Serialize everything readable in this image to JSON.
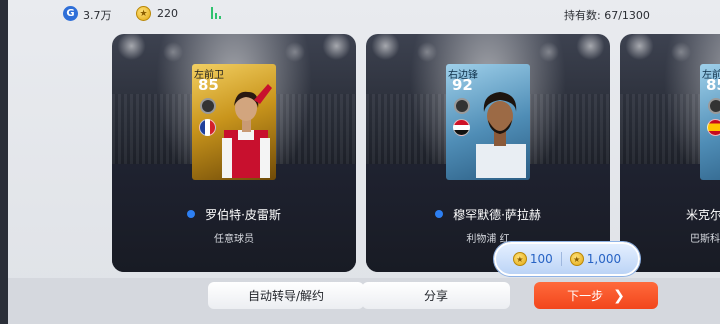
{
  "topbar": {
    "gp_value": "3.7万",
    "coins_value": "220",
    "owned_label": "持有数: 67/1300"
  },
  "cards": [
    {
      "position": "左前卫",
      "rating": "85",
      "name": "罗伯特·皮雷斯",
      "subtitle": "任意球员",
      "flag": "France",
      "card_style": "gold"
    },
    {
      "position": "右边锋",
      "rating": "92",
      "name": "穆罕默德·萨拉赫",
      "subtitle": "利物浦 红",
      "flag": "Egypt",
      "card_style": "blue"
    },
    {
      "position": "左前",
      "rating": "85",
      "name": "米克尔",
      "subtitle": "巴斯科",
      "flag": "Spain",
      "card_style": "blue"
    }
  ],
  "price": {
    "option1": "100",
    "option2": "1,000"
  },
  "bottom": {
    "auto_label": "自动转导/解约",
    "share_label": "分享",
    "next_label": "下一步"
  },
  "colors": {
    "accent_blue": "#2d7ff2",
    "next_button": "#f2461c",
    "gold_coin": "#e2a812"
  }
}
